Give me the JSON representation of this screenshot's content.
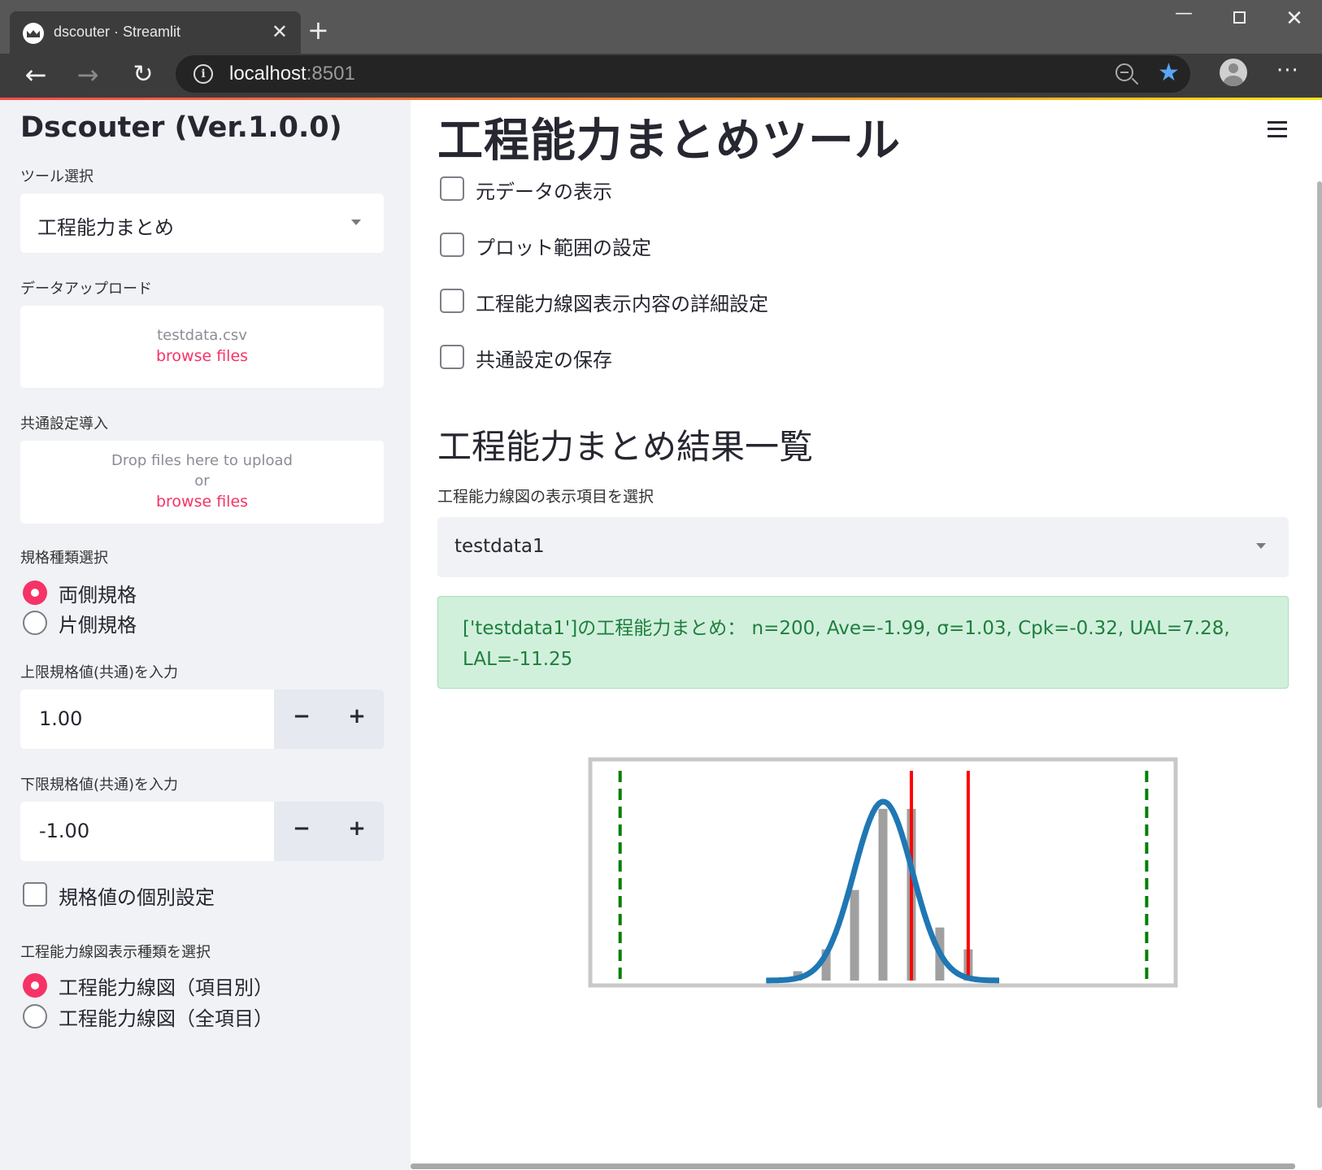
{
  "browser": {
    "tab_title": "dscouter · Streamlit",
    "tab_close": "✕",
    "new_tab": "+",
    "window_controls": {
      "minimize": "—",
      "close": "✕"
    },
    "nav": {
      "back": "←",
      "forward": "→",
      "reload": "↻"
    },
    "url": {
      "host": "localhost",
      "port": ":8501"
    },
    "icons": [
      "info-icon",
      "zoom-icon",
      "star-icon",
      "profile-icon",
      "more-icon"
    ],
    "star": "★",
    "more": "···"
  },
  "sidebar": {
    "title": "Dscouter (Ver.1.0.0)",
    "tool_select": {
      "label": "ツール選択",
      "value": "工程能力まとめ"
    },
    "data_upload": {
      "label": "データアップロード",
      "filename": "testdata.csv",
      "browse": "browse files"
    },
    "common_settings_import": {
      "label": "共通設定導入",
      "drop_text": "Drop files here to upload",
      "or": "or",
      "browse": "browse files"
    },
    "spec_type": {
      "label": "規格種類選択",
      "options": [
        "両側規格",
        "片側規格"
      ],
      "selected": 0
    },
    "upper_spec": {
      "label": "上限規格値(共通)を入力",
      "value": "1.00",
      "minus": "−",
      "plus": "+"
    },
    "lower_spec": {
      "label": "下限規格値(共通)を入力",
      "value": "-1.00",
      "minus": "−",
      "plus": "+"
    },
    "individual_spec_checkbox": "規格値の個別設定",
    "chart_type": {
      "label": "工程能力線図表示種類を選択",
      "options": [
        "工程能力線図（項目別）",
        "工程能力線図（全項目）"
      ],
      "selected": 0
    }
  },
  "main": {
    "title": "工程能力まとめツール",
    "checkboxes": [
      "元データの表示",
      "プロット範囲の設定",
      "工程能力線図表示内容の詳細設定",
      "共通設定の保存"
    ],
    "results_title": "工程能力まとめ結果一覧",
    "item_select": {
      "label": "工程能力線図の表示項目を選択",
      "value": "testdata1"
    },
    "summary": "['testdata1']の工程能力まとめ：  n=200, Ave=-1.99, σ=1.03, Cpk=-0.32, UAL=7.28, LAL=-11.25"
  },
  "colors": {
    "accent": "#f63366",
    "success_bg": "#d1f0dc",
    "success_text": "#1e7e3e",
    "curve": "#1f77b4",
    "spec_lines": "#ff0000",
    "limit_lines": "#008000",
    "bars": "#a0a0a0"
  },
  "chart_data": {
    "type": "bar",
    "description_series": [
      {
        "name": "histogram",
        "kind": "bar",
        "x": [
          -5,
          -4,
          -3,
          -2,
          -1,
          0,
          1
        ],
        "values": [
          3,
          10,
          29,
          55,
          55,
          17,
          10
        ]
      },
      {
        "name": "normal fit",
        "kind": "line",
        "mean": -1.99,
        "sigma": 1.03
      }
    ],
    "spec_lines": {
      "USL": 1.0,
      "LSL": -1.0
    },
    "control_limits": {
      "UAL": 7.28,
      "LAL": -11.25
    },
    "xlim": [
      -12.3,
      8.3
    ],
    "grid": false,
    "title": "",
    "xlabel": "",
    "ylabel": ""
  }
}
